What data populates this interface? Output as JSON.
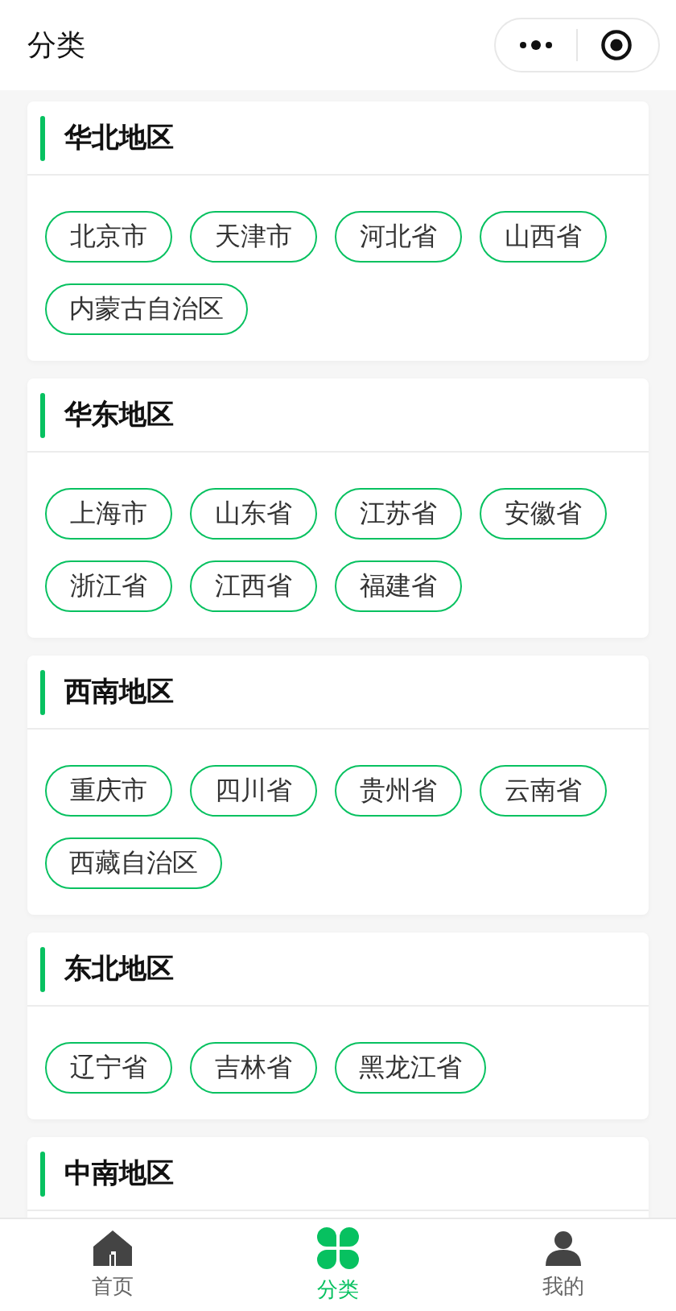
{
  "nav_bar": {
    "title": "分类"
  },
  "regions": [
    {
      "title": "华北地区",
      "tags": [
        "北京市",
        "天津市",
        "河北省",
        "山西省",
        "内蒙古自治区"
      ]
    },
    {
      "title": "华东地区",
      "tags": [
        "上海市",
        "山东省",
        "江苏省",
        "安徽省",
        "浙江省",
        "江西省",
        "福建省"
      ]
    },
    {
      "title": "西南地区",
      "tags": [
        "重庆市",
        "四川省",
        "贵州省",
        "云南省",
        "西藏自治区"
      ]
    },
    {
      "title": "东北地区",
      "tags": [
        "辽宁省",
        "吉林省",
        "黑龙江省"
      ]
    },
    {
      "title": "中南地区"
    }
  ],
  "tab_bar": [
    {
      "kind": "home",
      "label": "首页",
      "selected": false
    },
    {
      "kind": "category",
      "label": "分类",
      "selected": true
    },
    {
      "kind": "profile",
      "label": "我的",
      "selected": false
    }
  ]
}
